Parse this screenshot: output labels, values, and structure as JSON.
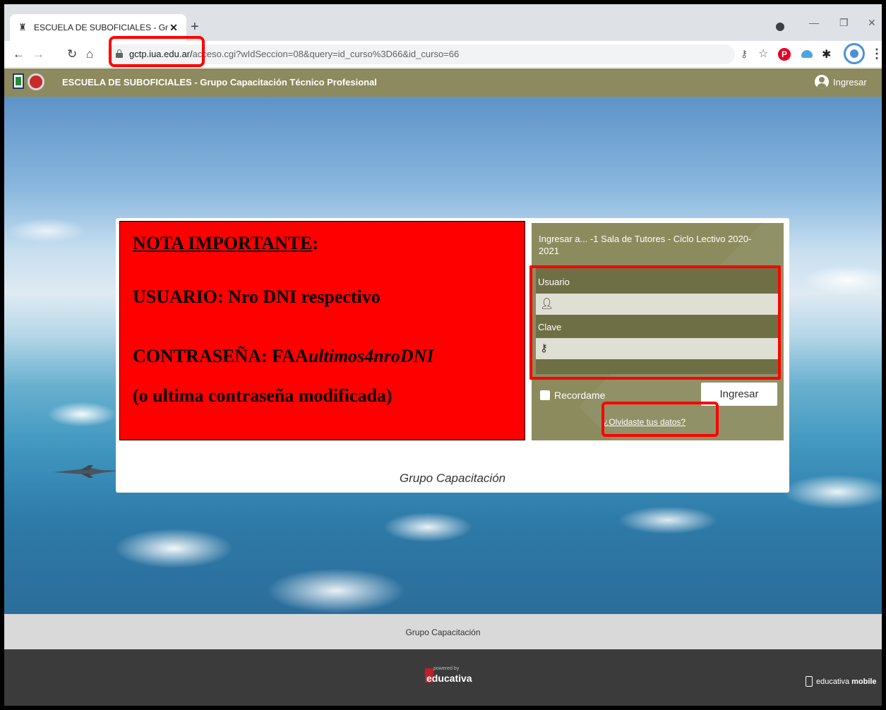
{
  "browser": {
    "tab_title": "ESCUELA DE SUBOFICIALES - Gru",
    "url_host": "gctp.iua.edu.ar/",
    "url_path": "acceso.cgi?wIdSeccion=08&query=id_curso%3D66&id_curso=66"
  },
  "header": {
    "site_title": "ESCUELA DE SUBOFICIALES - Grupo Capacitación Técnico Profesional",
    "login_label": "Ingresar"
  },
  "note": {
    "heading": "NOTA IMPORTANTE",
    "heading_colon": ":",
    "user_line": "USUARIO: Nro DNI respectivo",
    "password_prefix": "CONTRASEÑA:  FAA",
    "password_italic": "ultimos4nroDNI",
    "last_line": "(o ultima contraseña modificada)"
  },
  "login": {
    "title": "Ingresar a... -1 Sala de Tutores - Ciclo Lectivo 2020-2021",
    "user_label": "Usuario",
    "password_label": "Clave",
    "remember_label": "Recordame",
    "submit_label": "Ingresar",
    "forgot_link": "¿Olvidaste tus datos?"
  },
  "card_footer": "Grupo Capacitación",
  "footer": {
    "grey_text": "Grupo Capacitación",
    "powered_by": "powered by",
    "brand": "educativa",
    "mobile_prefix": "educativa",
    "mobile_bold": "mobile"
  },
  "colors": {
    "header_bg": "#8c8a5e",
    "note_bg": "#ff0000",
    "highlight": "#ff0000",
    "footer_dark": "#3b3b3b"
  }
}
